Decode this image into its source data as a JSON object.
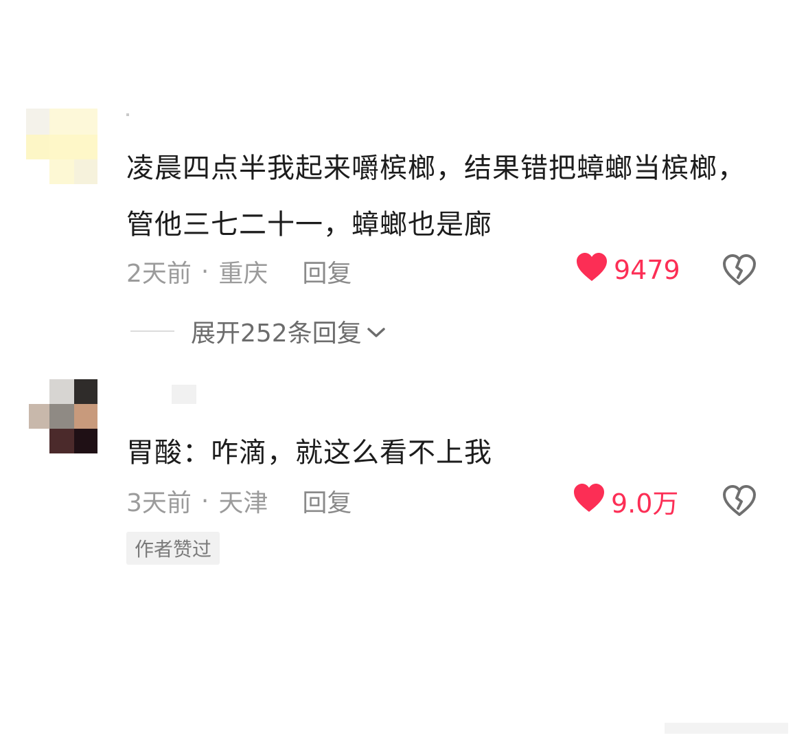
{
  "comments": [
    {
      "text": "凌晨四点半我起来嚼槟榔，结果错把蟑螂当槟榔，管他三七二十一，蟑螂也是廊",
      "time": "2天前",
      "location": "重庆",
      "reply_label": "回复",
      "likes": "9479",
      "expand_label": "展开252条回复"
    },
    {
      "text": "胃酸：咋滴，就这么看不上我",
      "time": "3天前",
      "location": "天津",
      "reply_label": "回复",
      "likes": "9.0万",
      "badge": "作者赞过"
    }
  ],
  "separator": "·",
  "colors": {
    "like": "#fc2e55",
    "meta": "#9b9b9b",
    "text": "#1c1c1c"
  },
  "icons": [
    "heart-icon",
    "broken-heart-icon",
    "chevron-down-icon"
  ]
}
